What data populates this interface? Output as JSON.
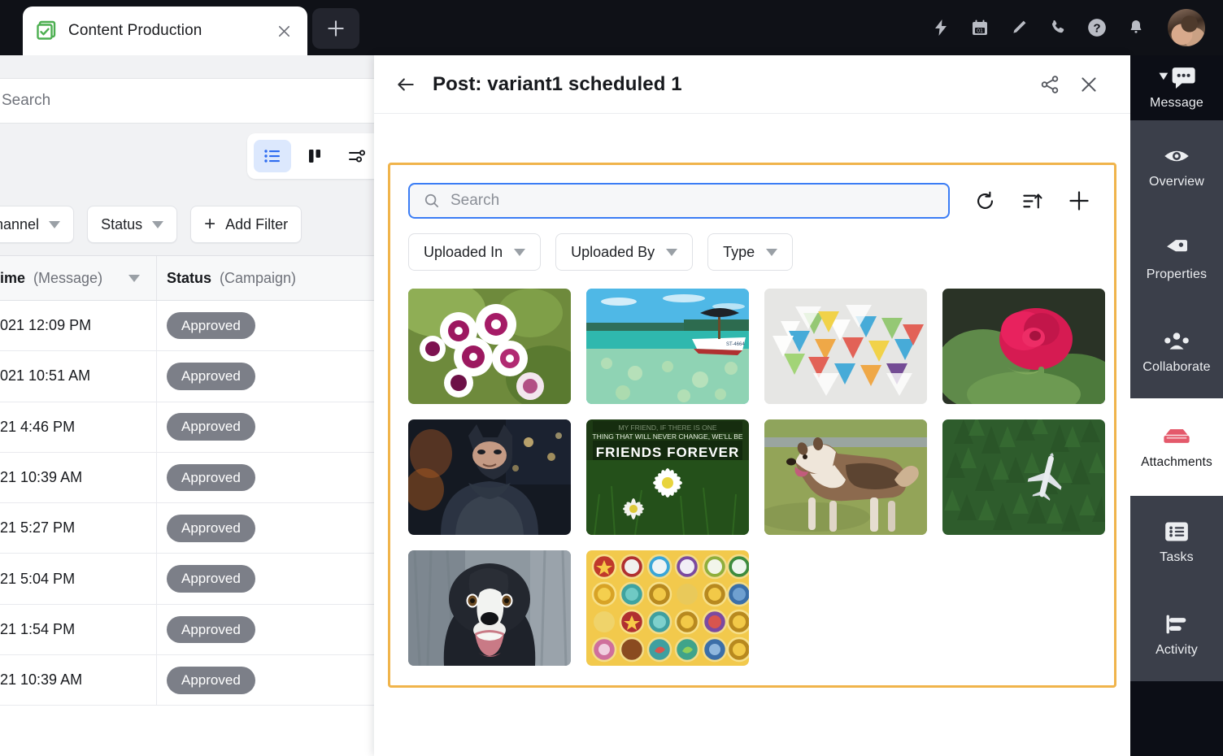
{
  "browser": {
    "tab_title": "Content Production",
    "favicon": "checklist-icon",
    "close_label": "×",
    "new_tab_label": "+",
    "toolbar_icons": [
      {
        "name": "lightning-icon"
      },
      {
        "name": "calendar-icon",
        "label": "01"
      },
      {
        "name": "pencil-icon"
      },
      {
        "name": "phone-icon"
      },
      {
        "name": "help-icon"
      },
      {
        "name": "bell-icon"
      },
      {
        "name": "avatar"
      }
    ]
  },
  "left_page": {
    "search_placeholder": "Search",
    "view_switcher": [
      {
        "name": "list-view-icon",
        "active": true
      },
      {
        "name": "board-view-icon",
        "active": false
      },
      {
        "name": "settings-sliders-icon",
        "active": false
      }
    ],
    "filters": [
      {
        "label": "Channel",
        "type": "dropdown"
      },
      {
        "label": "Status",
        "type": "dropdown"
      },
      {
        "label": "Add Filter",
        "type": "button"
      }
    ],
    "table": {
      "columns": [
        {
          "bold": "ime",
          "sub": "(Message)",
          "sortable": true
        },
        {
          "bold": "Status",
          "sub": "(Campaign)",
          "sortable": false
        }
      ],
      "rows": [
        {
          "time": "021 12:09 PM",
          "status": "Approved"
        },
        {
          "time": "021 10:51 AM",
          "status": "Approved"
        },
        {
          "time": "21 4:46 PM",
          "status": "Approved"
        },
        {
          "time": "21 10:39 AM",
          "status": "Approved"
        },
        {
          "time": "21 5:27 PM",
          "status": "Approved"
        },
        {
          "time": "21 5:04 PM",
          "status": "Approved"
        },
        {
          "time": "21 1:54 PM",
          "status": "Approved"
        },
        {
          "time": "21 10:39 AM",
          "status": "Approved"
        }
      ]
    }
  },
  "modal": {
    "back_icon": "arrow-left-icon",
    "title": "Post: variant1 scheduled 1",
    "share_icon": "share-icon",
    "close_icon": "close-icon",
    "highlight_color": "#f0b44b"
  },
  "picker": {
    "search": {
      "placeholder": "Search",
      "value": "",
      "icon": "search-icon",
      "focus_color": "#3b7df5"
    },
    "actions": [
      {
        "name": "refresh-icon"
      },
      {
        "name": "sort-ascending-icon"
      },
      {
        "name": "add-icon"
      }
    ],
    "filters": [
      {
        "label": "Uploaded In"
      },
      {
        "label": "Uploaded By"
      },
      {
        "label": "Type"
      }
    ],
    "assets": [
      {
        "name": "asset-pink-white-flowers"
      },
      {
        "name": "asset-boat-turquoise-sea"
      },
      {
        "name": "asset-abstract-triangles"
      },
      {
        "name": "asset-red-rose"
      },
      {
        "name": "asset-batman"
      },
      {
        "name": "asset-friends-forever-daisies",
        "caption": "FRIENDS FOREVER"
      },
      {
        "name": "asset-husky-dog"
      },
      {
        "name": "asset-plane-over-forest"
      },
      {
        "name": "asset-border-collie"
      },
      {
        "name": "asset-game-bubbles"
      }
    ]
  },
  "rail": {
    "items": [
      {
        "label": "Message",
        "icon": "chat-bubble-icon",
        "theme": "dark",
        "has_caret": true
      },
      {
        "label": "Overview",
        "icon": "eye-icon",
        "theme": "grey"
      },
      {
        "label": "Properties",
        "icon": "tag-icon",
        "theme": "grey"
      },
      {
        "label": "Collaborate",
        "icon": "people-icon",
        "theme": "grey"
      },
      {
        "label": "Attachments",
        "icon": "attachment-box-icon",
        "theme": "white",
        "accent": "#e4596b"
      },
      {
        "label": "Tasks",
        "icon": "list-icon",
        "theme": "grey"
      },
      {
        "label": "Activity",
        "icon": "activity-icon",
        "theme": "grey"
      }
    ]
  }
}
